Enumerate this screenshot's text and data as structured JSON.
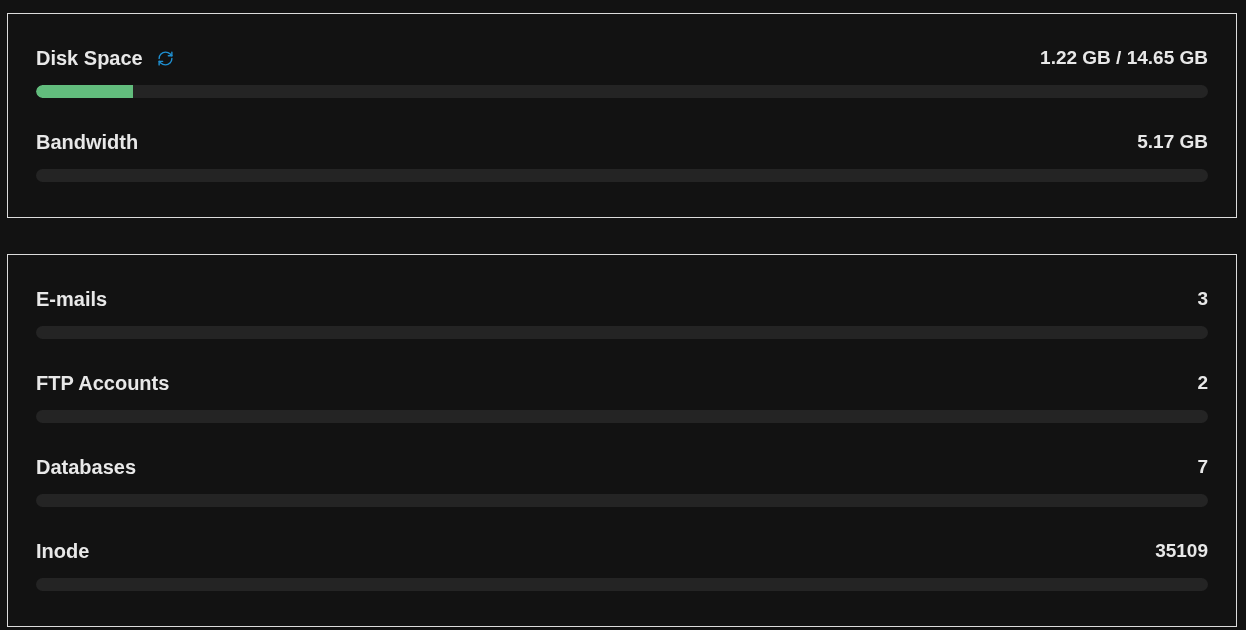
{
  "cards": [
    {
      "rows": [
        {
          "label": "Disk Space",
          "refreshable": true,
          "value": "1.22 GB / 14.65 GB",
          "level": 0.083
        },
        {
          "label": "Bandwidth",
          "refreshable": false,
          "value": "5.17 GB"
        }
      ]
    },
    {
      "rows": [
        {
          "label": "E-mails",
          "refreshable": false,
          "value": "3"
        },
        {
          "label": "FTP Accounts",
          "refreshable": false,
          "value": "2"
        },
        {
          "label": "Databases",
          "refreshable": false,
          "value": "7"
        },
        {
          "label": "Inode",
          "refreshable": false,
          "value": "35109"
        }
      ]
    }
  ]
}
